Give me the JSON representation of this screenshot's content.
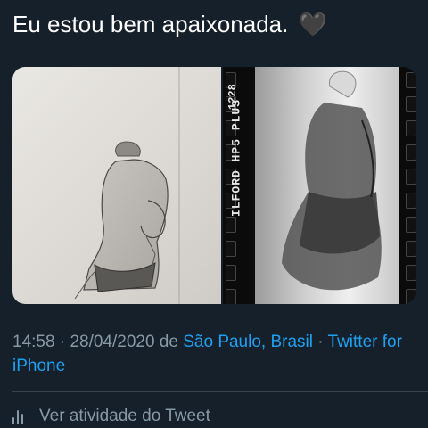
{
  "tweet": {
    "text": "Eu estou bem apaixonada.",
    "emoji": "🖤"
  },
  "media": {
    "film_brand_label": "ILFORD HP5 PLUS",
    "film_frame_number": "1228"
  },
  "meta": {
    "time": "14:58",
    "separator1": " · ",
    "date": "28/04/2020",
    "from_word": " de ",
    "location": "São Paulo, Brasil",
    "separator2": " · ",
    "source": "Twitter for iPhone"
  },
  "activity": {
    "label": "Ver atividade do Tweet",
    "icon": "analytics-bars-icon"
  },
  "colors": {
    "background": "#15202b",
    "text": "#ffffff",
    "secondary_text": "#8899a6",
    "link": "#1da1f2",
    "divider": "#38444d"
  }
}
